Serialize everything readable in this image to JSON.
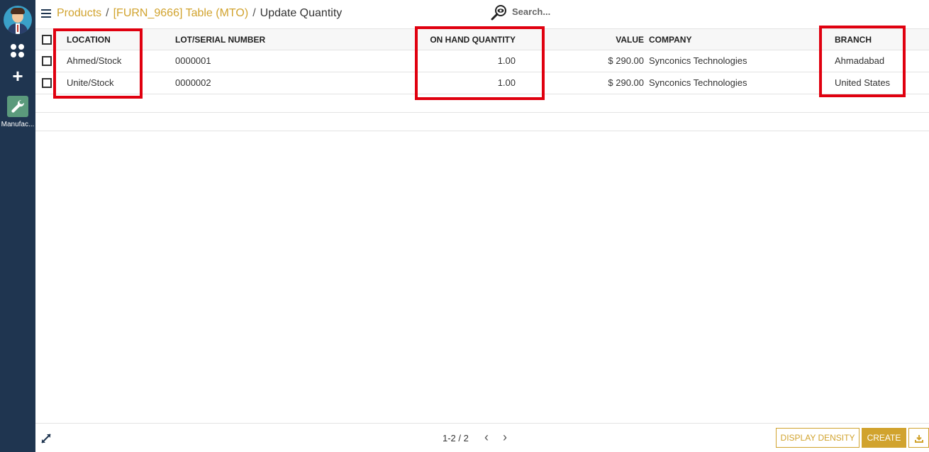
{
  "rail": {
    "app_label": "Manufac..."
  },
  "breadcrumb": {
    "items": [
      "Products",
      "[FURN_9666] Table (MTO)"
    ],
    "separator": "/",
    "current": "Update Quantity"
  },
  "search": {
    "placeholder": "Search..."
  },
  "table": {
    "columns": {
      "location": "LOCATION",
      "lot": "LOT/SERIAL NUMBER",
      "on_hand": "ON HAND QUANTITY",
      "value": "VALUE",
      "company": "COMPANY",
      "branch": "BRANCH"
    },
    "rows": [
      {
        "location": "Ahmed/Stock",
        "lot": "0000001",
        "on_hand": "1.00",
        "value": "$ 290.00",
        "company": "Synconics Technologies",
        "branch": "Ahmadabad"
      },
      {
        "location": "Unite/Stock",
        "lot": "0000002",
        "on_hand": "1.00",
        "value": "$ 290.00",
        "company": "Synconics Technologies",
        "branch": "United States"
      }
    ]
  },
  "footer": {
    "pager": "1-2 / 2",
    "display_density": "DISPLAY DENSITY",
    "create": "CREATE"
  },
  "colors": {
    "rail_bg": "#1f3550",
    "accent": "#d1a32e",
    "highlight": "#e0000f"
  }
}
